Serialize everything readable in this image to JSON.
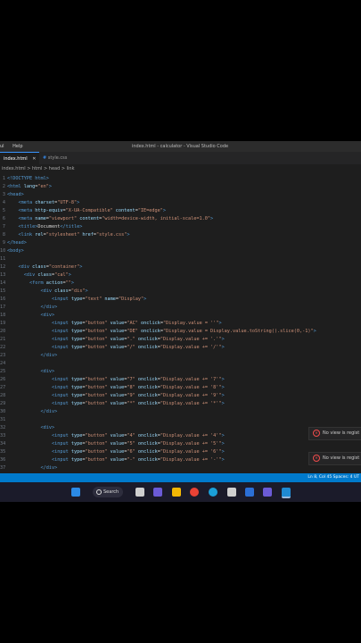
{
  "menu": [
    "ul",
    "Help"
  ],
  "window_title": "index.html - calculator - Visual Studio Code",
  "tabs": [
    {
      "label": "index.html",
      "active": true
    },
    {
      "label": "style.css",
      "active": false
    }
  ],
  "breadcrumb": "index.html > html > head > link",
  "code_lines": [
    {
      "n": "1",
      "parts": [
        [
          "tag",
          "<!DOCTYPE html>"
        ]
      ]
    },
    {
      "n": "2",
      "parts": [
        [
          "tag",
          "<html "
        ],
        [
          "attr",
          "lang"
        ],
        [
          "txt",
          "="
        ],
        [
          "str",
          "\"en\""
        ],
        [
          "tag",
          ">"
        ]
      ]
    },
    {
      "n": "3",
      "parts": [
        [
          "tag",
          "<head>"
        ]
      ]
    },
    {
      "n": "4",
      "parts": [
        [
          "tag",
          "    <meta "
        ],
        [
          "attr",
          "charset"
        ],
        [
          "txt",
          "="
        ],
        [
          "str",
          "\"UTF-8\""
        ],
        [
          "tag",
          ">"
        ]
      ]
    },
    {
      "n": "5",
      "parts": [
        [
          "tag",
          "    <meta "
        ],
        [
          "attr",
          "http-equiv"
        ],
        [
          "txt",
          "="
        ],
        [
          "str",
          "\"X-UA-Compatible\""
        ],
        [
          "attr",
          " content"
        ],
        [
          "txt",
          "="
        ],
        [
          "str",
          "\"IE=edge\""
        ],
        [
          "tag",
          ">"
        ]
      ]
    },
    {
      "n": "6",
      "parts": [
        [
          "tag",
          "    <meta "
        ],
        [
          "attr",
          "name"
        ],
        [
          "txt",
          "="
        ],
        [
          "str",
          "\"viewport\""
        ],
        [
          "attr",
          " content"
        ],
        [
          "txt",
          "="
        ],
        [
          "str",
          "\"width=device-width, initial-scale=1.0\""
        ],
        [
          "tag",
          ">"
        ]
      ]
    },
    {
      "n": "7",
      "parts": [
        [
          "tag",
          "    <title>"
        ],
        [
          "txt",
          "Document"
        ],
        [
          "tag",
          "</title>"
        ]
      ]
    },
    {
      "n": "8",
      "parts": [
        [
          "tag",
          "    <link "
        ],
        [
          "attr",
          "rel"
        ],
        [
          "txt",
          "="
        ],
        [
          "str",
          "\"stylesheet\""
        ],
        [
          "attr",
          " href"
        ],
        [
          "txt",
          "="
        ],
        [
          "str",
          "\"style.css\""
        ],
        [
          "tag",
          ">"
        ]
      ]
    },
    {
      "n": "9",
      "parts": [
        [
          "tag",
          "</head>"
        ]
      ]
    },
    {
      "n": "10",
      "parts": [
        [
          "tag",
          "<body>"
        ]
      ]
    },
    {
      "n": "11",
      "parts": []
    },
    {
      "n": "12",
      "parts": [
        [
          "tag",
          "    <div "
        ],
        [
          "attr",
          "class"
        ],
        [
          "txt",
          "="
        ],
        [
          "str",
          "\"container\""
        ],
        [
          "tag",
          ">"
        ]
      ]
    },
    {
      "n": "13",
      "parts": [
        [
          "tag",
          "      <div "
        ],
        [
          "attr",
          "class"
        ],
        [
          "txt",
          "="
        ],
        [
          "str",
          "\"cal\""
        ],
        [
          "tag",
          ">"
        ]
      ]
    },
    {
      "n": "14",
      "parts": [
        [
          "tag",
          "        <form "
        ],
        [
          "attr",
          "action"
        ],
        [
          "txt",
          "="
        ],
        [
          "str",
          "\"\""
        ],
        [
          "tag",
          ">"
        ]
      ]
    },
    {
      "n": "15",
      "parts": [
        [
          "tag",
          "            <div "
        ],
        [
          "attr",
          "class"
        ],
        [
          "txt",
          "="
        ],
        [
          "str",
          "\"dis\""
        ],
        [
          "tag",
          ">"
        ]
      ]
    },
    {
      "n": "16",
      "parts": [
        [
          "tag",
          "                <input "
        ],
        [
          "attr",
          "type"
        ],
        [
          "txt",
          "="
        ],
        [
          "str",
          "\"text\""
        ],
        [
          "attr",
          " name"
        ],
        [
          "txt",
          "="
        ],
        [
          "str",
          "\"Display\""
        ],
        [
          "tag",
          ">"
        ]
      ]
    },
    {
      "n": "17",
      "parts": [
        [
          "tag",
          "            </div>"
        ]
      ]
    },
    {
      "n": "18",
      "parts": [
        [
          "tag",
          "            <div>"
        ]
      ]
    },
    {
      "n": "19",
      "parts": [
        [
          "tag",
          "                <input "
        ],
        [
          "attr",
          "type"
        ],
        [
          "txt",
          "="
        ],
        [
          "str",
          "\"button\""
        ],
        [
          "attr",
          " value"
        ],
        [
          "txt",
          "="
        ],
        [
          "str",
          "\"AC\""
        ],
        [
          "attr",
          " onclick"
        ],
        [
          "txt",
          "="
        ],
        [
          "str",
          "\"Display.value = ''\""
        ],
        [
          "tag",
          ">"
        ]
      ]
    },
    {
      "n": "20",
      "parts": [
        [
          "tag",
          "                <input "
        ],
        [
          "attr",
          "type"
        ],
        [
          "txt",
          "="
        ],
        [
          "str",
          "\"button\""
        ],
        [
          "attr",
          " value"
        ],
        [
          "txt",
          "="
        ],
        [
          "str",
          "\"DE\""
        ],
        [
          "attr",
          " onclick"
        ],
        [
          "txt",
          "="
        ],
        [
          "str",
          "\"Display.value = Display.value.toString().slice(0,-1)\""
        ],
        [
          "tag",
          ">"
        ]
      ]
    },
    {
      "n": "21",
      "parts": [
        [
          "tag",
          "                <input "
        ],
        [
          "attr",
          "type"
        ],
        [
          "txt",
          "="
        ],
        [
          "str",
          "\"button\""
        ],
        [
          "attr",
          " value"
        ],
        [
          "txt",
          "="
        ],
        [
          "str",
          "\".\""
        ],
        [
          "attr",
          " onclick"
        ],
        [
          "txt",
          "="
        ],
        [
          "str",
          "\"Display.value += '.'\""
        ],
        [
          "tag",
          ">"
        ]
      ]
    },
    {
      "n": "22",
      "parts": [
        [
          "tag",
          "                <input "
        ],
        [
          "attr",
          "type"
        ],
        [
          "txt",
          "="
        ],
        [
          "str",
          "\"button\""
        ],
        [
          "attr",
          " value"
        ],
        [
          "txt",
          "="
        ],
        [
          "str",
          "\"/\""
        ],
        [
          "attr",
          " onclick"
        ],
        [
          "txt",
          "="
        ],
        [
          "str",
          "\"Display.value += '/'\""
        ],
        [
          "tag",
          ">"
        ]
      ]
    },
    {
      "n": "23",
      "parts": [
        [
          "tag",
          "            </div>"
        ]
      ]
    },
    {
      "n": "24",
      "parts": []
    },
    {
      "n": "25",
      "parts": [
        [
          "tag",
          "            <div>"
        ]
      ]
    },
    {
      "n": "26",
      "parts": [
        [
          "tag",
          "                <input "
        ],
        [
          "attr",
          "type"
        ],
        [
          "txt",
          "="
        ],
        [
          "str",
          "\"button\""
        ],
        [
          "attr",
          " value"
        ],
        [
          "txt",
          "="
        ],
        [
          "str",
          "\"7\""
        ],
        [
          "attr",
          " onclick"
        ],
        [
          "txt",
          "="
        ],
        [
          "str",
          "\"Display.value += '7'\""
        ],
        [
          "tag",
          ">"
        ]
      ]
    },
    {
      "n": "27",
      "parts": [
        [
          "tag",
          "                <input "
        ],
        [
          "attr",
          "type"
        ],
        [
          "txt",
          "="
        ],
        [
          "str",
          "\"button\""
        ],
        [
          "attr",
          " value"
        ],
        [
          "txt",
          "="
        ],
        [
          "str",
          "\"8\""
        ],
        [
          "attr",
          " onclick"
        ],
        [
          "txt",
          "="
        ],
        [
          "str",
          "\"Display.value += '8'\""
        ],
        [
          "tag",
          ">"
        ]
      ]
    },
    {
      "n": "28",
      "parts": [
        [
          "tag",
          "                <input "
        ],
        [
          "attr",
          "type"
        ],
        [
          "txt",
          "="
        ],
        [
          "str",
          "\"button\""
        ],
        [
          "attr",
          " value"
        ],
        [
          "txt",
          "="
        ],
        [
          "str",
          "\"9\""
        ],
        [
          "attr",
          " onclick"
        ],
        [
          "txt",
          "="
        ],
        [
          "str",
          "\"Display.value += '9'\""
        ],
        [
          "tag",
          ">"
        ]
      ]
    },
    {
      "n": "29",
      "parts": [
        [
          "tag",
          "                <input "
        ],
        [
          "attr",
          "type"
        ],
        [
          "txt",
          "="
        ],
        [
          "str",
          "\"button\""
        ],
        [
          "attr",
          " value"
        ],
        [
          "txt",
          "="
        ],
        [
          "str",
          "\"*\""
        ],
        [
          "attr",
          " onclick"
        ],
        [
          "txt",
          "="
        ],
        [
          "str",
          "\"Display.value += '*'\""
        ],
        [
          "tag",
          ">"
        ]
      ]
    },
    {
      "n": "30",
      "parts": [
        [
          "tag",
          "            </div>"
        ]
      ]
    },
    {
      "n": "31",
      "parts": []
    },
    {
      "n": "32",
      "parts": [
        [
          "tag",
          "            <div>"
        ]
      ]
    },
    {
      "n": "33",
      "parts": [
        [
          "tag",
          "                <input "
        ],
        [
          "attr",
          "type"
        ],
        [
          "txt",
          "="
        ],
        [
          "str",
          "\"button\""
        ],
        [
          "attr",
          " value"
        ],
        [
          "txt",
          "="
        ],
        [
          "str",
          "\"4\""
        ],
        [
          "attr",
          " onclick"
        ],
        [
          "txt",
          "="
        ],
        [
          "str",
          "\"Display.value += '4'\""
        ],
        [
          "tag",
          ">"
        ]
      ]
    },
    {
      "n": "34",
      "parts": [
        [
          "tag",
          "                <input "
        ],
        [
          "attr",
          "type"
        ],
        [
          "txt",
          "="
        ],
        [
          "str",
          "\"button\""
        ],
        [
          "attr",
          " value"
        ],
        [
          "txt",
          "="
        ],
        [
          "str",
          "\"5\""
        ],
        [
          "attr",
          " onclick"
        ],
        [
          "txt",
          "="
        ],
        [
          "str",
          "\"Display.value += '5'\""
        ],
        [
          "tag",
          ">"
        ]
      ]
    },
    {
      "n": "35",
      "parts": [
        [
          "tag",
          "                <input "
        ],
        [
          "attr",
          "type"
        ],
        [
          "txt",
          "="
        ],
        [
          "str",
          "\"button\""
        ],
        [
          "attr",
          " value"
        ],
        [
          "txt",
          "="
        ],
        [
          "str",
          "\"6\""
        ],
        [
          "attr",
          " onclick"
        ],
        [
          "txt",
          "="
        ],
        [
          "str",
          "\"Display.value += '6'\""
        ],
        [
          "tag",
          ">"
        ]
      ]
    },
    {
      "n": "36",
      "parts": [
        [
          "tag",
          "                <input "
        ],
        [
          "attr",
          "type"
        ],
        [
          "txt",
          "="
        ],
        [
          "str",
          "\"button\""
        ],
        [
          "attr",
          " value"
        ],
        [
          "txt",
          "="
        ],
        [
          "str",
          "\"-\""
        ],
        [
          "attr",
          " onclick"
        ],
        [
          "txt",
          "="
        ],
        [
          "str",
          "\"Display.value += '-'\""
        ],
        [
          "tag",
          ">"
        ]
      ]
    },
    {
      "n": "37",
      "parts": [
        [
          "tag",
          "            </div>"
        ]
      ]
    }
  ],
  "notifications": [
    "No view is regist",
    "No view is regist"
  ],
  "status": {
    "right": "Ln 8, Col 45   Spaces: 4   UT"
  },
  "taskbar": {
    "search_label": "Search"
  },
  "colors": {
    "status_bar": "#007acc",
    "editor_bg": "#1e1e1e",
    "tag": "#569cd6",
    "attr": "#9cdcfe",
    "string": "#ce9178"
  }
}
